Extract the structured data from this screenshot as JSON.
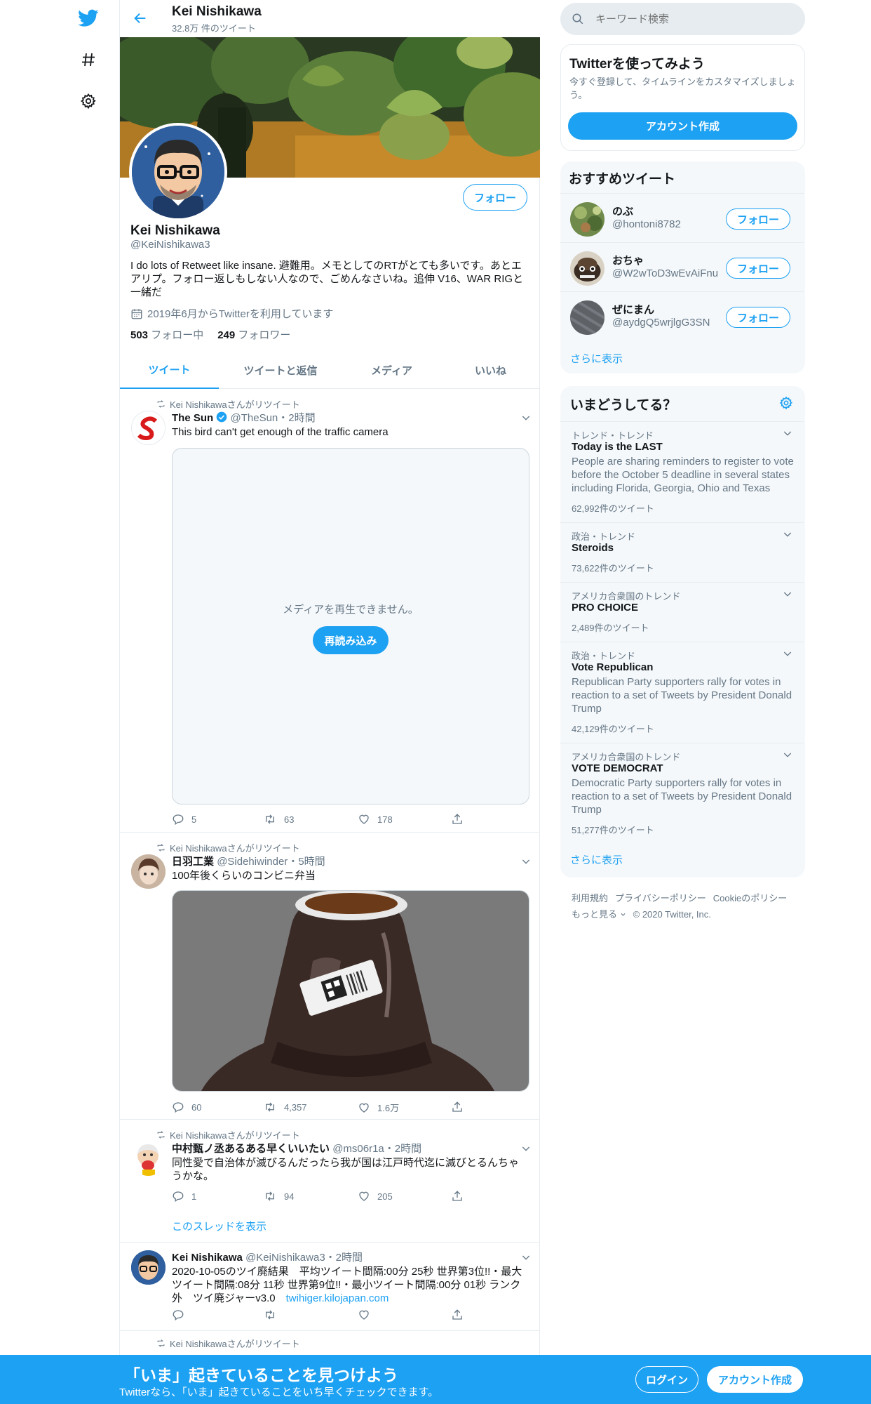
{
  "header": {
    "name": "Kei Nishikawa",
    "tweet_count": "32.8万 件のツイート"
  },
  "profile": {
    "name": "Kei Nishikawa",
    "handle": "@KeiNishikawa3",
    "follow_label": "フォロー",
    "bio_line1": "I do lots of Retweet like insane. 避難用。メモとしてのRTがとても多いです。あとエ",
    "bio_line2": "アリプ。フォロー返しもしない人なので、ごめんなさいね。追伸 V16、WAR RIGと",
    "bio_line3": "一緒だ",
    "joined": "2019年6月からTwitterを利用しています",
    "following_count": "503",
    "following_label": "フォロー中",
    "followers_count": "249",
    "followers_label": "フォロワー"
  },
  "tabs": [
    "ツイート",
    "ツイートと返信",
    "メディア",
    "いいね"
  ],
  "tweets": [
    {
      "retweet_label": "Kei Nishikawaさんがリツイート",
      "name": "The Sun",
      "handle": "@TheSun",
      "time": "・2時間",
      "text": "This bird can't get enough of the traffic camera",
      "media_error": "メディアを再生できません。",
      "reload": "再読み込み",
      "replies": "5",
      "retweets": "63",
      "likes": "178"
    },
    {
      "retweet_label": "Kei Nishikawaさんがリツイート",
      "name": "日羽工業",
      "handle": "@Sidehiwinder",
      "time": "・5時間",
      "text": "100年後くらいのコンビニ弁当",
      "replies": "60",
      "retweets": "4,357",
      "likes": "1.6万"
    },
    {
      "retweet_label": "Kei Nishikawaさんがリツイート",
      "name": "中村甄ノ丞あるある早くいいたい",
      "handle": "@ms06r1a",
      "time": "・2時間",
      "text_line1": "同性愛で自治体が滅びるんだったら我が国は江戸時代迄に滅びとるんちゃ",
      "text_line2": "うかな。",
      "replies": "1",
      "retweets": "94",
      "likes": "205",
      "thread_link": "このスレッドを表示"
    },
    {
      "name": "Kei Nishikawa",
      "handle": "@KeiNishikawa3",
      "time": "・2時間",
      "text_line1": "2020-10-05のツイ廃結果　平均ツイート間隔:00分 25秒 世界第3位!!・最大",
      "text_line2": "ツイート間隔:08分 11秒 世界第9位!!・最小ツイート間隔:00分 01秒 ランク",
      "text_line3": "外　ツイ廃ジャーv3.0",
      "link": "twihiger.kilojapan.com"
    },
    {
      "retweet_label": "Kei Nishikawaさんがリツイート"
    }
  ],
  "search": {
    "placeholder": "キーワード検索"
  },
  "signup_card": {
    "title": "Twitterを使ってみよう",
    "desc_line1": "今すぐ登録して、タイムラインをカスタマイズしましょ",
    "desc_line2": "う。",
    "button": "アカウント作成"
  },
  "suggestions": {
    "title": "おすすめツイート",
    "users": [
      {
        "name": "のぶ",
        "handle": "@hontoni8782",
        "follow": "フォロー"
      },
      {
        "name": "おちゃ",
        "handle": "@W2wToD3wEvAiFnu",
        "follow": "フォロー"
      },
      {
        "name": "ぜにまん",
        "handle": "@aydgQ5wrjlgG3SN",
        "follow": "フォロー"
      }
    ],
    "more": "さらに表示"
  },
  "trends": {
    "title": "いまどうしてる？",
    "items": [
      {
        "category": "トレンド・トレンド",
        "name": "Today is the LAST",
        "desc_line1": "People are sharing reminders to register to vote",
        "desc_line2": "before the October 5 deadline in several states",
        "desc_line3": "including Florida, Georgia, Ohio and Texas",
        "count": "62,992件のツイート"
      },
      {
        "category": "政治・トレンド",
        "name": "Steroids",
        "count": "73,622件のツイート"
      },
      {
        "category": "アメリカ合衆国のトレンド",
        "name": "PRO CHOICE",
        "count": "2,489件のツイート"
      },
      {
        "category": "政治・トレンド",
        "name": "Vote Republican",
        "desc_line1": "Republican Party supporters rally for votes in",
        "desc_line2": "reaction to a set of Tweets by President Donald",
        "desc_line3": "Trump",
        "count": "42,129件のツイート"
      },
      {
        "category": "アメリカ合衆国のトレンド",
        "name": "VOTE DEMOCRAT",
        "desc_line1": "Democratic Party supporters rally for votes in",
        "desc_line2": "reaction to a set of Tweets by President Donald",
        "desc_line3": "Trump",
        "count": "51,277件のツイート"
      }
    ],
    "more": "さらに表示"
  },
  "footer": {
    "terms": "利用規約",
    "privacy": "プライバシーポリシー",
    "cookie": "Cookieのポリシー",
    "more": "もっと見る",
    "copyright": "© 2020 Twitter, Inc."
  },
  "bottom_bar": {
    "title": "「いま」起きていることを見つけよう",
    "subtitle": "Twitterなら、「いま」起きていることをいち早くチェックできます。",
    "login": "ログイン",
    "signup": "アカウント作成"
  },
  "colors": {
    "brand": "#1da1f2",
    "muted": "#657786",
    "text": "#14171a",
    "border": "#e6ecf0",
    "panel": "#f5f8fa"
  }
}
